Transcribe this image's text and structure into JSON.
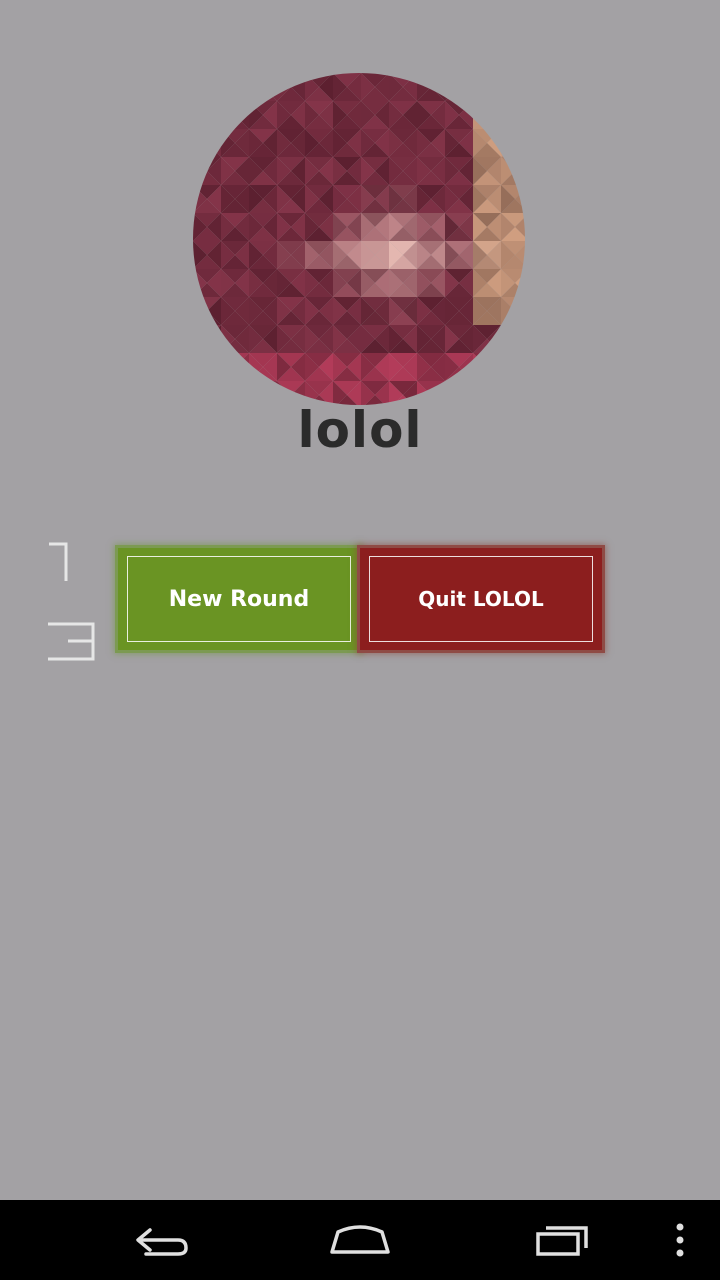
{
  "app": {
    "title": "lolol",
    "logo_icon": "pixel-triangle-mosaic-logo"
  },
  "glyphs": {
    "top_icon": "corner-bracket-glyph",
    "bottom_icon": "reversed-e-glyph"
  },
  "actions": {
    "new_round_label": "New Round",
    "quit_label": "Quit LOLOL"
  },
  "colors": {
    "background": "#a3a1a4",
    "new_round": "#6a9423",
    "quit": "#8c1e1e",
    "title_text": "#2b2b2b",
    "navbar": "#000000"
  },
  "navbar": {
    "back_icon": "back-arrow-icon",
    "home_icon": "home-icon",
    "recents_icon": "recent-apps-icon",
    "menu_icon": "overflow-menu-icon"
  }
}
